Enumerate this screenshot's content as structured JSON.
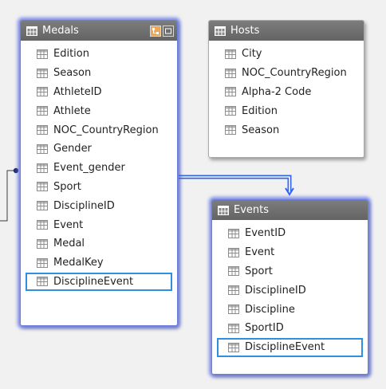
{
  "tables": [
    {
      "name": "Medals",
      "fields": [
        "Edition",
        "Season",
        "AthleteID",
        "Athlete",
        "NOC_CountryRegion",
        "Gender",
        "Event_gender",
        "Sport",
        "DisciplineID",
        "Event",
        "Medal",
        "MedalKey",
        "DisciplineEvent"
      ],
      "highlighted_field": "DisciplineEvent",
      "selected": true
    },
    {
      "name": "Hosts",
      "fields": [
        "City",
        "NOC_CountryRegion",
        "Alpha-2 Code",
        "Edition",
        "Season"
      ],
      "selected": false
    },
    {
      "name": "Events",
      "fields": [
        "EventID",
        "Event",
        "Sport",
        "DisciplineID",
        "Discipline",
        "SportID",
        "DisciplineEvent"
      ],
      "highlighted_field": "DisciplineEvent",
      "selected": true
    }
  ],
  "icons": {
    "table": "table-grid-icon",
    "column": "column-grid-icon",
    "hierarchy": "hierarchy-icon",
    "maximize": "maximize-icon"
  },
  "colors": {
    "header_bg": "#6f6f6f",
    "selection_glow": "#5a6ee6",
    "highlight_border": "#2f8fe0",
    "relationship_line": "#3366ee",
    "canvas_bg": "#f1f1f1"
  }
}
